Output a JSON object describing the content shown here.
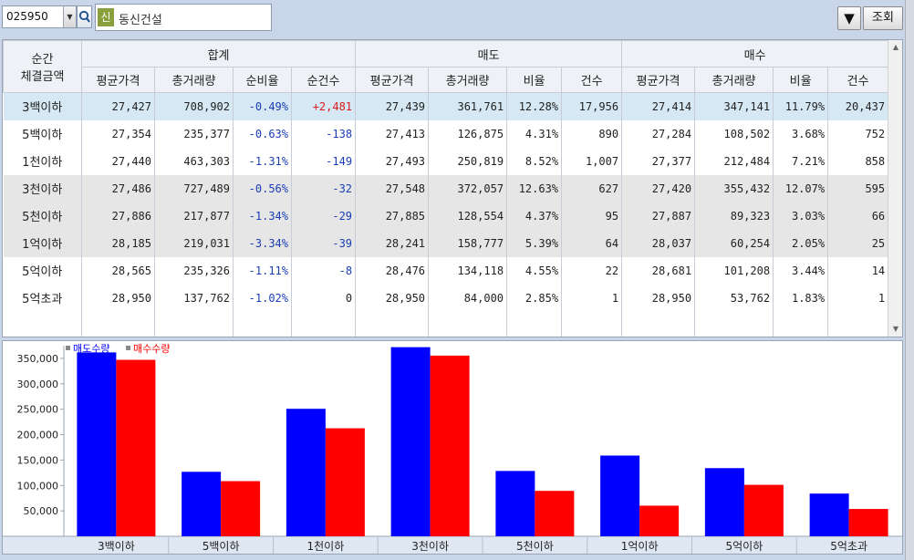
{
  "toolbar": {
    "stock_code": "025950",
    "badge": "신",
    "stock_name": "동신건설",
    "more_icon": "▼",
    "query_label": "조회"
  },
  "table": {
    "corner_header": [
      "순간",
      "체결금액"
    ],
    "group_headers": [
      "합계",
      "매도",
      "매수"
    ],
    "sub_headers": [
      "평균가격",
      "총거래량",
      "순비율",
      "순건수",
      "평균가격",
      "총거래량",
      "비율",
      "건수",
      "평균가격",
      "총거래량",
      "비율",
      "건수"
    ],
    "rows": [
      {
        "label": "3백이하",
        "cells": [
          "27,427",
          "708,902",
          "-0.49%",
          "+2,481",
          "27,439",
          "361,761",
          "12.28%",
          "17,956",
          "27,414",
          "347,141",
          "11.79%",
          "20,437"
        ]
      },
      {
        "label": "5백이하",
        "cells": [
          "27,354",
          "235,377",
          "-0.63%",
          "-138",
          "27,413",
          "126,875",
          "4.31%",
          "890",
          "27,284",
          "108,502",
          "3.68%",
          "752"
        ]
      },
      {
        "label": "1천이하",
        "cells": [
          "27,440",
          "463,303",
          "-1.31%",
          "-149",
          "27,493",
          "250,819",
          "8.52%",
          "1,007",
          "27,377",
          "212,484",
          "7.21%",
          "858"
        ]
      },
      {
        "label": "3천이하",
        "cells": [
          "27,486",
          "727,489",
          "-0.56%",
          "-32",
          "27,548",
          "372,057",
          "12.63%",
          "627",
          "27,420",
          "355,432",
          "12.07%",
          "595"
        ]
      },
      {
        "label": "5천이하",
        "cells": [
          "27,886",
          "217,877",
          "-1.34%",
          "-29",
          "27,885",
          "128,554",
          "4.37%",
          "95",
          "27,887",
          "89,323",
          "3.03%",
          "66"
        ]
      },
      {
        "label": "1억이하",
        "cells": [
          "28,185",
          "219,031",
          "-3.34%",
          "-39",
          "28,241",
          "158,777",
          "5.39%",
          "64",
          "28,037",
          "60,254",
          "2.05%",
          "25"
        ]
      },
      {
        "label": "5억이하",
        "cells": [
          "28,565",
          "235,326",
          "-1.11%",
          "-8",
          "28,476",
          "134,118",
          "4.55%",
          "22",
          "28,681",
          "101,208",
          "3.44%",
          "14"
        ]
      },
      {
        "label": "5억초과",
        "cells": [
          "28,950",
          "137,762",
          "-1.02%",
          "0",
          "28,950",
          "84,000",
          "2.85%",
          "1",
          "28,950",
          "53,762",
          "1.83%",
          "1"
        ]
      }
    ]
  },
  "colors": {
    "sell": "#0000ff",
    "buy": "#ff0000",
    "negative": "#1a3db5",
    "positive": "#d81b1b",
    "selected_row": "#d5e8f4"
  },
  "chart_data": {
    "type": "bar",
    "categories": [
      "3백이하",
      "5백이하",
      "1천이하",
      "3천이하",
      "5천이하",
      "1억이하",
      "5억이하",
      "5억초과"
    ],
    "series": [
      {
        "name": "매도수량",
        "color": "#0000ff",
        "values": [
          361761,
          126875,
          250819,
          372057,
          128554,
          158777,
          134118,
          84000
        ]
      },
      {
        "name": "매수수량",
        "color": "#ff0000",
        "values": [
          347141,
          108502,
          212484,
          355432,
          89323,
          60254,
          101208,
          53762
        ]
      }
    ],
    "yticks": [
      "50,000",
      "100,000",
      "150,000",
      "200,000",
      "250,000",
      "300,000",
      "350,000"
    ],
    "ylim": [
      0,
      375000
    ],
    "grid": false,
    "legend": "top-left"
  }
}
